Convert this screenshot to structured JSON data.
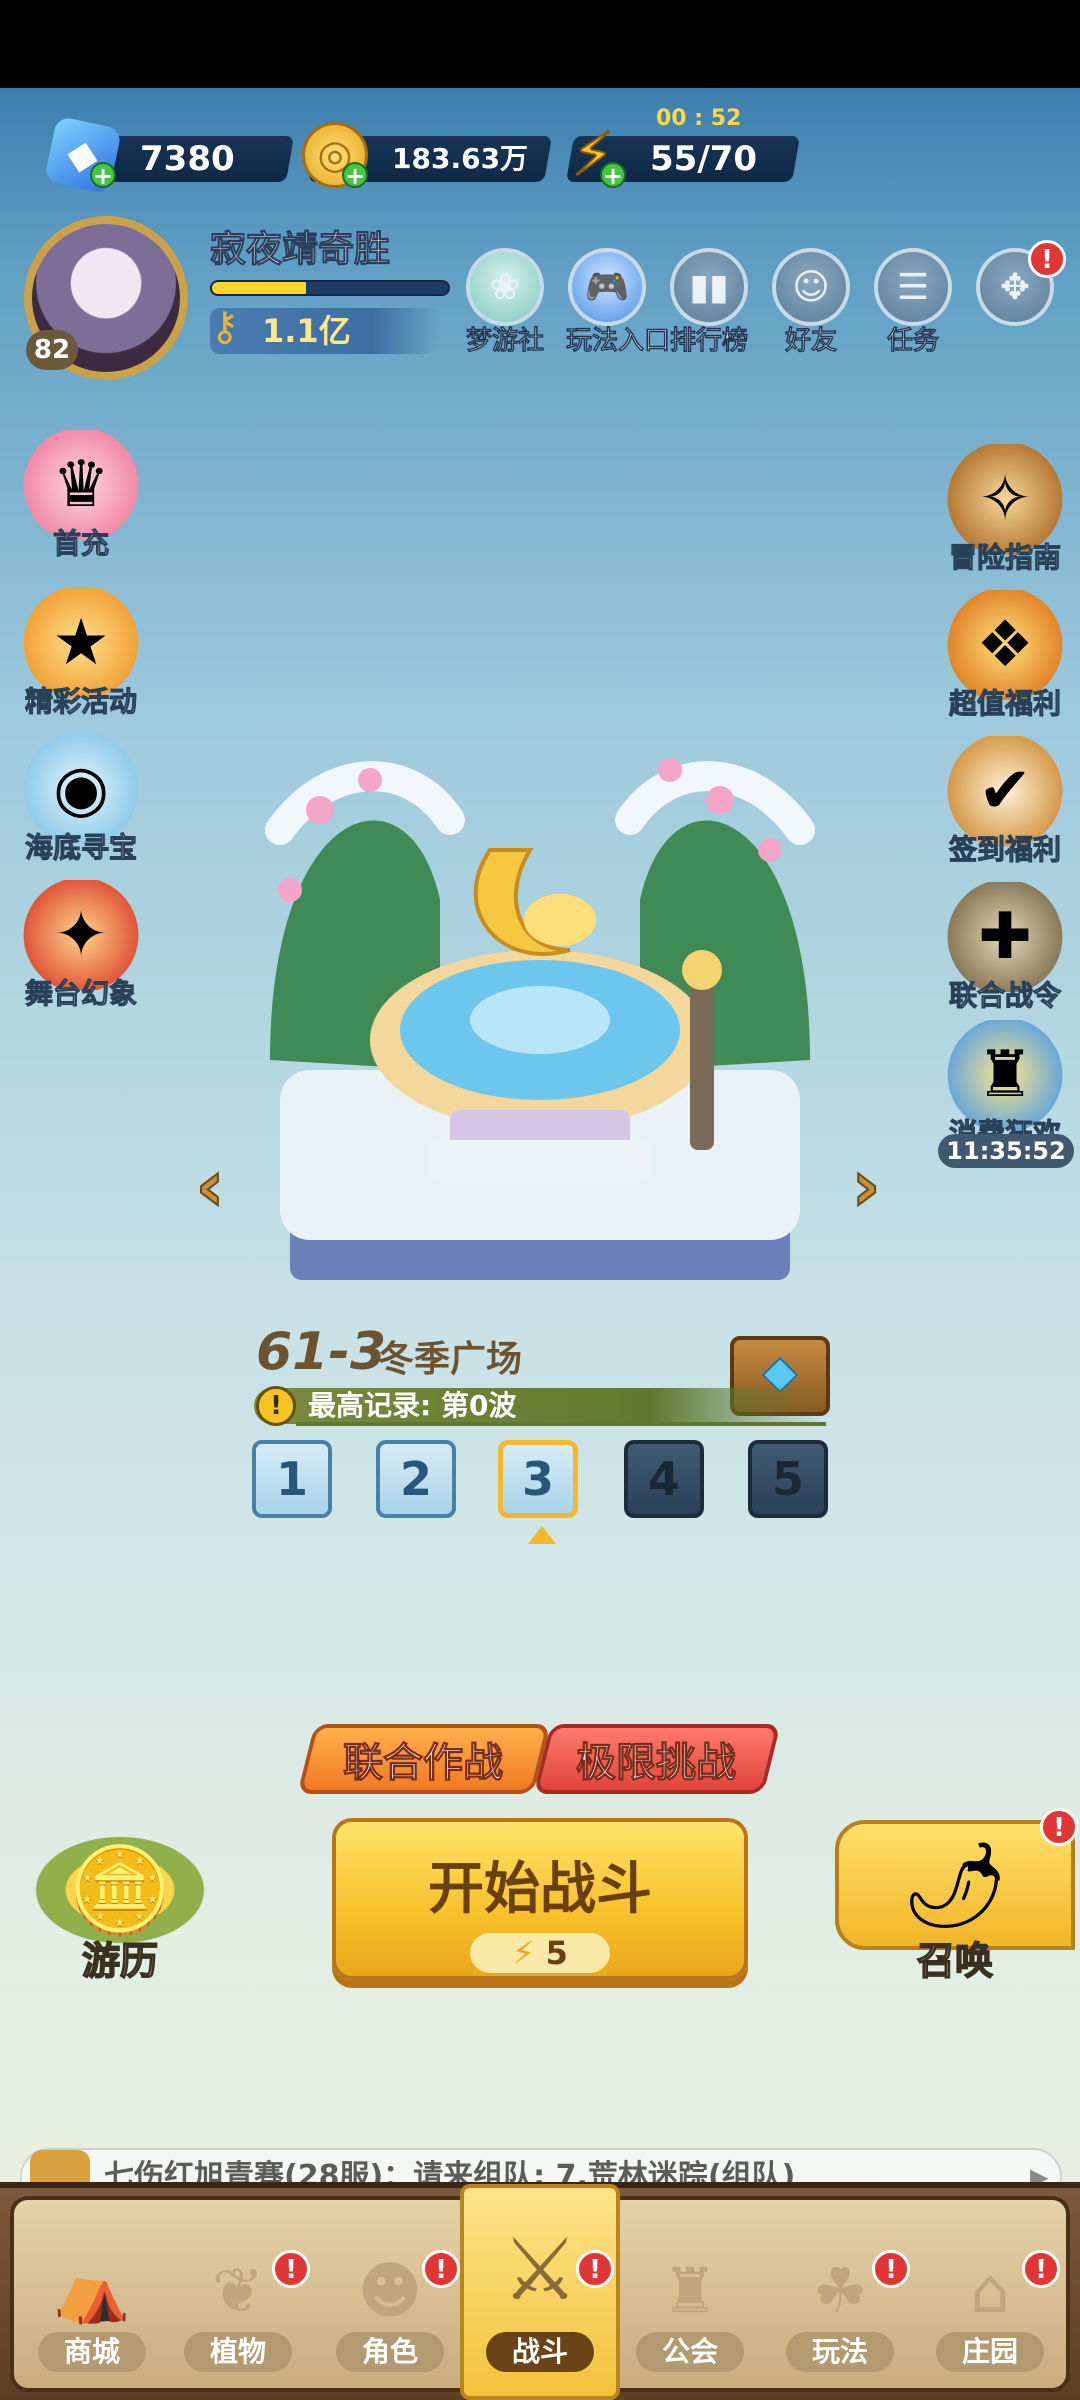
{
  "resources": {
    "gems": "7380",
    "coins": "183.63万",
    "energy": "55/70",
    "energy_timer": "00 : 52"
  },
  "player": {
    "name": "寂夜靖奇胜",
    "level": "82",
    "power": "1.1亿",
    "xp_fraction": 0.4
  },
  "top_menu": [
    {
      "label": "梦游社",
      "icon": "dream-club-icon"
    },
    {
      "label": "玩法入口",
      "icon": "gamepad-icon"
    },
    {
      "label": "排行榜",
      "icon": "leaderboard-icon"
    },
    {
      "label": "好友",
      "icon": "friends-icon"
    },
    {
      "label": "任务",
      "icon": "tasks-icon"
    },
    {
      "label": "",
      "icon": "more-icon",
      "badge": "!"
    }
  ],
  "left_side": [
    {
      "label": "首充",
      "icon": "first-recharge-icon"
    },
    {
      "label": "精彩活动",
      "icon": "events-icon"
    },
    {
      "label": "海底寻宝",
      "icon": "treasure-hunt-icon"
    },
    {
      "label": "舞台幻象",
      "icon": "stage-illusion-icon"
    }
  ],
  "right_side": [
    {
      "label": "冒险指南",
      "icon": "adventure-guide-icon"
    },
    {
      "label": "超值福利",
      "icon": "value-bonus-icon"
    },
    {
      "label": "签到福利",
      "icon": "check-in-icon"
    },
    {
      "label": "联合战令",
      "icon": "battle-pass-icon"
    },
    {
      "label": "消费狂欢",
      "icon": "spending-carnival-icon",
      "timer": "11:35:52"
    }
  ],
  "stage": {
    "number": "61-3",
    "name": "冬季广场",
    "record": "最高记录: 第0波",
    "waves": [
      "1",
      "2",
      "3",
      "4",
      "5"
    ],
    "current_wave": 3
  },
  "modes": {
    "coop": "联合作战",
    "challenge": "极限挑战"
  },
  "start": {
    "label": "开始战斗",
    "cost": "5"
  },
  "travel_label": "游历",
  "summon_label": "召唤",
  "summon_badge": "!",
  "chat": {
    "text": "七伤红旭青骞(28服)：请来组队: 7.荒林迷踪(组队)",
    "icon": "chat-bubble-icon"
  },
  "nav": [
    {
      "label": "商城",
      "icon": "shop-icon",
      "badge": ""
    },
    {
      "label": "植物",
      "icon": "plant-icon",
      "badge": "!"
    },
    {
      "label": "角色",
      "icon": "character-icon",
      "badge": "!"
    },
    {
      "label": "战斗",
      "icon": "battle-icon",
      "badge": "!",
      "active": true
    },
    {
      "label": "公会",
      "icon": "guild-icon",
      "badge": ""
    },
    {
      "label": "玩法",
      "icon": "modes-icon",
      "badge": "!"
    },
    {
      "label": "庄园",
      "icon": "manor-icon",
      "badge": "!"
    }
  ],
  "colors": {
    "accent_gold": "#f7c12a",
    "badge_red": "#e23535",
    "coop_orange": "#f58a2c",
    "challenge_red": "#e8524a"
  }
}
